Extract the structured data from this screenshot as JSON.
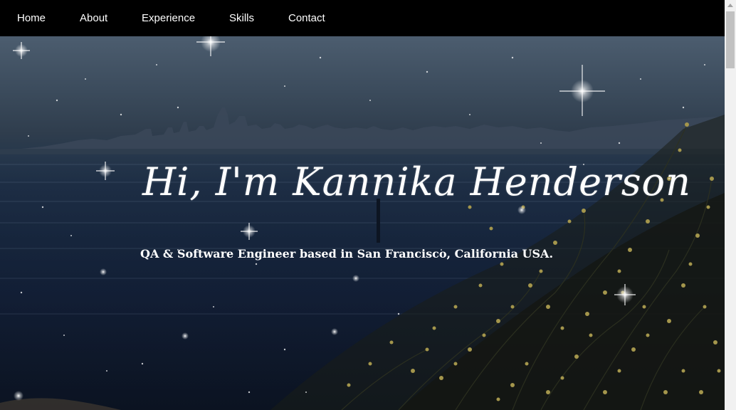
{
  "nav": {
    "items": [
      {
        "label": "Home"
      },
      {
        "label": "About"
      },
      {
        "label": "Experience"
      },
      {
        "label": "Skills"
      },
      {
        "label": "Contact"
      }
    ]
  },
  "hero": {
    "title": "Hi, I'm Kannika Henderson",
    "subtitle": "QA & Software Engineer based in San Francisco, California USA."
  },
  "colors": {
    "navbar": "#000000",
    "text": "#ffffff",
    "sky": "#4c5d6f",
    "water": "#192a44"
  }
}
